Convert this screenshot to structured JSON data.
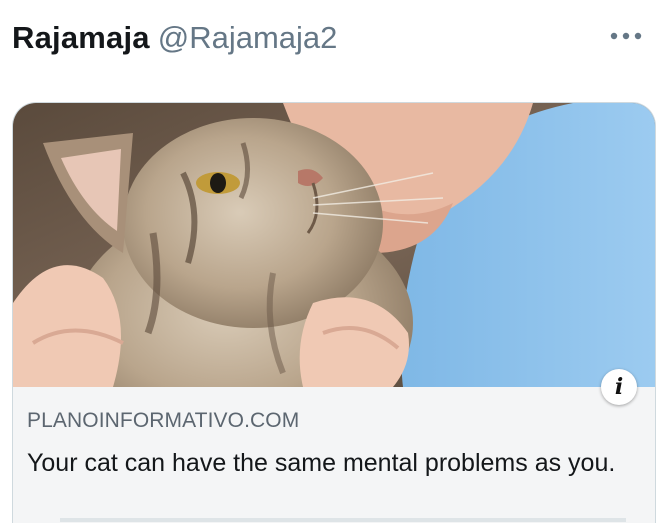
{
  "tweet": {
    "display_name": "Rajamaja",
    "handle": "@Rajamaja2"
  },
  "card": {
    "image": "person-holding-cat-photo",
    "domain": "PLANOINFORMATIVO.COM",
    "title": "Your cat can have the same mental problems as you."
  },
  "icons": {
    "more": "more-horizontal-icon",
    "info": "info-icon"
  }
}
